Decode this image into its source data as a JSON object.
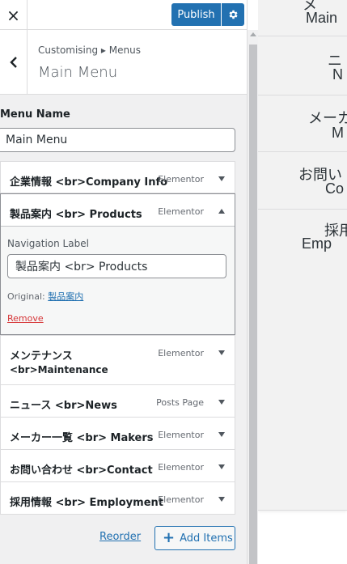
{
  "header": {
    "close_icon": "×",
    "publish_label": "Publish",
    "gear_icon": "gear-icon"
  },
  "section": {
    "breadcrumb": "Customising ▸ Menus",
    "title": "Main Menu",
    "back_icon": "chevron-left-icon"
  },
  "menu_name": {
    "label": "Menu Name",
    "value": "Main Menu"
  },
  "menu_items": [
    {
      "title": "企業情報 <br>Company Info",
      "type": "Elementor",
      "expanded": false
    },
    {
      "title": "製品案内 <br> Products",
      "type": "Elementor",
      "expanded": true,
      "settings": {
        "nav_label_caption": "Navigation Label",
        "nav_label_value": "製品案内 <br> Products",
        "original_prefix": "Original: ",
        "original_link": "製品案内",
        "remove_label": "Remove"
      }
    },
    {
      "title": "メンテナンス",
      "subtitle": "<br>Maintenance",
      "type": "Elementor",
      "expanded": false
    },
    {
      "title": "ニュース <br>News",
      "type": "Posts Page",
      "expanded": false
    },
    {
      "title": "メーカー一覧 <br> Makers",
      "type": "Elementor",
      "expanded": false
    },
    {
      "title": "お問い合わせ <br>Contact",
      "type": "Elementor",
      "expanded": false
    },
    {
      "title": "採用情報 <br> Employment",
      "type": "Elementor",
      "expanded": false
    }
  ],
  "footer": {
    "reorder_label": "Reorder",
    "add_items_label": "Add Items"
  },
  "preview": {
    "items": [
      {
        "line1": "メ",
        "line2": "Main"
      },
      {
        "line1": "ニ",
        "line2": "N"
      },
      {
        "line1": "メーカ",
        "line2": "M"
      },
      {
        "line1": "お問い",
        "line2": "Co"
      },
      {
        "line1": "採用",
        "line2": "Emp"
      }
    ]
  },
  "colors": {
    "accent": "#2271b1",
    "danger": "#d63638",
    "panel_bg": "#f0f0f1"
  }
}
